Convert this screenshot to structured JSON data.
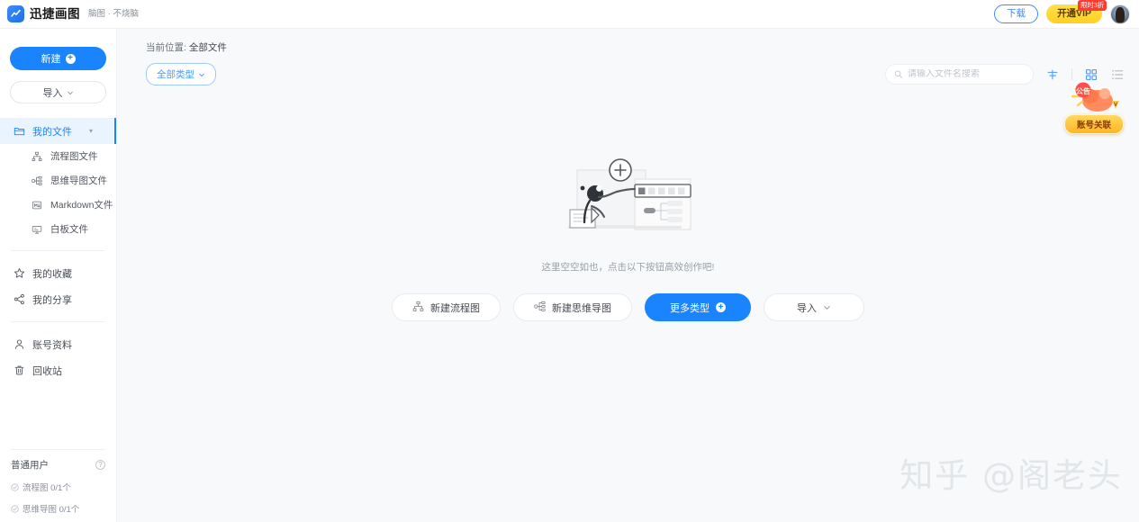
{
  "topbar": {
    "brand_name": "迅捷画图",
    "brand_tagline": "脑图 · 不烧脑",
    "logo_icon": "chart-line-logo-icon",
    "download_label": "下载",
    "vip_label": "开通VIP",
    "vip_badge": "限时3折",
    "avatar_name": "user-avatar"
  },
  "sidebar": {
    "new_label": "新建",
    "import_label": "导入",
    "nav": [
      {
        "label": "我的文件",
        "icon": "folder-icon",
        "active": true,
        "caret": "▾"
      },
      {
        "label": "流程图文件",
        "icon": "flowchart-icon"
      },
      {
        "label": "思维导图文件",
        "icon": "mindmap-icon"
      },
      {
        "label": "Markdown文件",
        "icon": "markdown-icon"
      },
      {
        "label": "白板文件",
        "icon": "whiteboard-icon"
      },
      {
        "label": "我的收藏",
        "icon": "star-icon"
      },
      {
        "label": "我的分享",
        "icon": "share-icon"
      },
      {
        "label": "账号资料",
        "icon": "person-icon"
      },
      {
        "label": "回收站",
        "icon": "trash-icon"
      }
    ],
    "user_level": "普通用户",
    "help_icon": "question-mark-icon",
    "quotas": [
      {
        "label": "流程图 0/1个"
      },
      {
        "label": "思维导图 0/1个"
      }
    ]
  },
  "main": {
    "breadcrumb_prefix": "当前位置:",
    "breadcrumb_value": "全部文件",
    "filter_label": "全部类型",
    "search_placeholder": "请输入文件名搜索",
    "search_value": "",
    "sort_icon": "sort-icon",
    "grid_view_icon": "grid-view-icon",
    "list_view_icon": "list-view-icon",
    "empty_illustration": "empty-create-illustration",
    "empty_text": "这里空空如也，点击以下按钮高效创作吧!",
    "actions": [
      {
        "label": "新建流程图",
        "icon": "flowchart-icon"
      },
      {
        "label": "新建思维导图",
        "icon": "mindmap-icon"
      },
      {
        "label": "更多类型",
        "icon": "plus-circle-icon",
        "primary": true
      },
      {
        "label": "导入",
        "icon": "chevron-down-icon"
      }
    ]
  },
  "promo": {
    "art_label": "gift-promo-illustration",
    "button_label": "账号关联"
  },
  "watermark": {
    "text": "知乎 @阁老头"
  },
  "colors": {
    "accent": "#1a84ff",
    "accent_light": "#eaf4ff",
    "vip_yellow": "#ffd021",
    "badge_red": "#ff3b30",
    "canvas_bg": "#f7f9fb"
  }
}
